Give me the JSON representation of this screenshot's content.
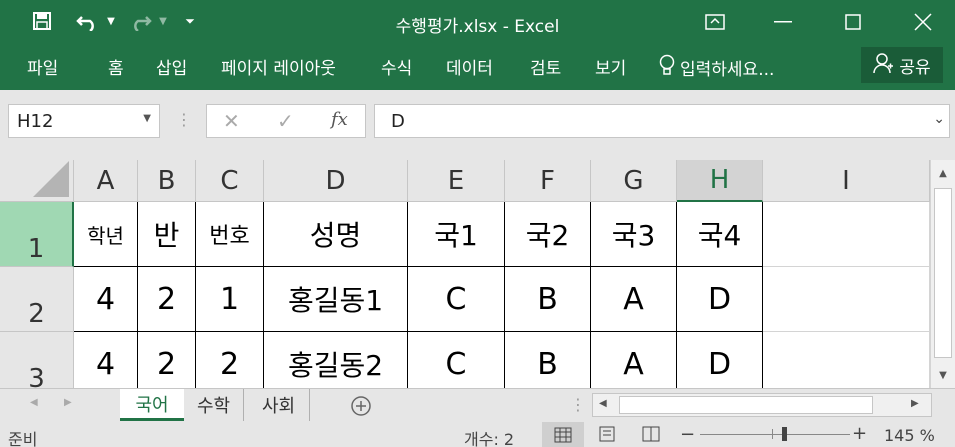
{
  "window": {
    "title": "수행평가.xlsx  -  Excel"
  },
  "quick_access": {
    "save_icon": "save-icon",
    "undo_icon": "undo-icon",
    "redo_icon": "redo-icon",
    "customize_icon": "customize-icon"
  },
  "ribbon": {
    "tabs": [
      "파일",
      "홈",
      "삽입",
      "페이지 레이아웃",
      "수식",
      "데이터",
      "검토",
      "보기"
    ],
    "tell_me": "입력하세요...",
    "share": "공유"
  },
  "formula_bar": {
    "name_box": "H12",
    "fx": "fx",
    "value": "D"
  },
  "sheet": {
    "columns": [
      "A",
      "B",
      "C",
      "D",
      "E",
      "F",
      "G",
      "H",
      "I"
    ],
    "selected_column": "H",
    "rows": [
      "1",
      "2",
      "3"
    ],
    "selected_row": "1",
    "cells": [
      [
        "학년",
        "반",
        "번호",
        "성명",
        "국1",
        "국2",
        "국3",
        "국4",
        ""
      ],
      [
        "4",
        "2",
        "1",
        "홍길동1",
        "C",
        "B",
        "A",
        "D",
        ""
      ],
      [
        "4",
        "2",
        "2",
        "홍길동2",
        "C",
        "B",
        "A",
        "D",
        ""
      ]
    ]
  },
  "sheet_tabs": [
    "국어",
    "수학",
    "사회"
  ],
  "active_tab": "국어",
  "status": {
    "mode": "준비",
    "count": "개수: 2",
    "zoom": "145 %"
  },
  "colors": {
    "accent": "#217346",
    "selected_header": "#a0d8b3"
  }
}
